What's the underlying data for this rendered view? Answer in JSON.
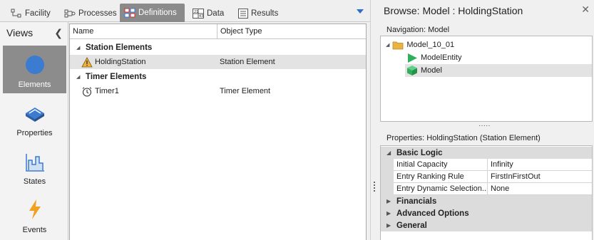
{
  "tabs": [
    {
      "label": "Facility",
      "icon": "facility-icon"
    },
    {
      "label": "Processes",
      "icon": "processes-icon"
    },
    {
      "label": "Definitions",
      "icon": "definitions-icon",
      "active": true
    },
    {
      "label": "Data",
      "icon": "data-icon"
    },
    {
      "label": "Results",
      "icon": "results-icon"
    }
  ],
  "views": {
    "title": "Views",
    "items": [
      {
        "label": "Elements",
        "icon": "elements-icon",
        "active": true
      },
      {
        "label": "Properties",
        "icon": "properties-icon"
      },
      {
        "label": "States",
        "icon": "states-icon"
      },
      {
        "label": "Events",
        "icon": "events-icon"
      }
    ]
  },
  "grid": {
    "columns": [
      "Name",
      "Object Type"
    ],
    "groups": [
      {
        "label": "Station Elements",
        "rows": [
          {
            "name": "HoldingStation",
            "type": "Station Element",
            "icon": "warning-icon",
            "selected": true
          }
        ]
      },
      {
        "label": "Timer Elements",
        "rows": [
          {
            "name": "Timer1",
            "type": "Timer Element",
            "icon": "timer-icon"
          }
        ]
      }
    ]
  },
  "browse": {
    "title": "Browse: Model : HoldingStation",
    "navigation_label": "Navigation: Model",
    "tree": {
      "root": "Model_10_01",
      "children": [
        {
          "label": "ModelEntity",
          "icon": "entity-icon"
        },
        {
          "label": "Model",
          "icon": "model-cube-icon",
          "selected": true
        }
      ]
    },
    "properties_label": "Properties: HoldingStation (Station Element)",
    "categories": [
      {
        "label": "Basic Logic",
        "expanded": true,
        "rows": [
          {
            "key": "Initial Capacity",
            "value": "Infinity"
          },
          {
            "key": "Entry Ranking Rule",
            "value": "FirstInFirstOut"
          },
          {
            "key": "Entry Dynamic Selection...",
            "value": "None"
          }
        ]
      },
      {
        "label": "Financials",
        "expanded": false
      },
      {
        "label": "Advanced Options",
        "expanded": false
      },
      {
        "label": "General",
        "expanded": false
      }
    ]
  },
  "colors": {
    "active_tab": "#8a8a8a",
    "elements_icon": "#3b7bd0",
    "entity_triangle": "#2fae5b",
    "model_cube": "#2fae5b",
    "events_bolt": "#f2a01f",
    "folder": "#e8b343",
    "warning": "#f0b23c"
  }
}
